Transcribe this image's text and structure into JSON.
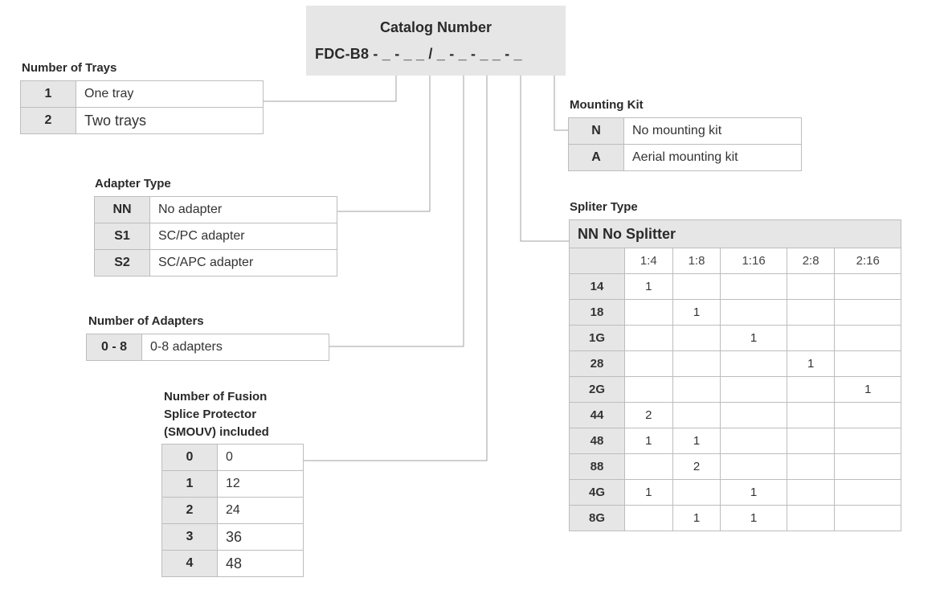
{
  "header": {
    "title": "Catalog Number",
    "code": "FDC-B8 - _ - _ _ / _ - _ - _ _ - _"
  },
  "trays": {
    "title": "Number of Trays",
    "rows": [
      {
        "key": "1",
        "value": "One tray"
      },
      {
        "key": "2",
        "value": "Two trays"
      }
    ]
  },
  "adapter_type": {
    "title": "Adapter Type",
    "rows": [
      {
        "key": "NN",
        "value": "No adapter"
      },
      {
        "key": "S1",
        "value": "SC/PC adapter"
      },
      {
        "key": "S2",
        "value": "SC/APC adapter"
      }
    ]
  },
  "num_adapters": {
    "title": "Number of Adapters",
    "rows": [
      {
        "key": "0 - 8",
        "value": "0-8 adapters"
      }
    ]
  },
  "splice": {
    "title_lines": [
      "Number of Fusion",
      "Splice Protector",
      "(SMOUV) included"
    ],
    "rows": [
      {
        "key": "0",
        "value": "0"
      },
      {
        "key": "1",
        "value": "12"
      },
      {
        "key": "2",
        "value": "24"
      },
      {
        "key": "3",
        "value": "36"
      },
      {
        "key": "4",
        "value": "48"
      }
    ]
  },
  "mounting": {
    "title": "Mounting Kit",
    "rows": [
      {
        "key": "N",
        "value": "No mounting kit"
      },
      {
        "key": "A",
        "value": "Aerial mounting kit"
      }
    ]
  },
  "splitter": {
    "title": "Spliter Type",
    "header": "NN No Splitter",
    "columns": [
      "1:4",
      "1:8",
      "1:16",
      "2:8",
      "2:16"
    ],
    "rows": [
      {
        "key": "14",
        "cells": [
          "1",
          "",
          "",
          "",
          ""
        ]
      },
      {
        "key": "18",
        "cells": [
          "",
          "1",
          "",
          "",
          ""
        ]
      },
      {
        "key": "1G",
        "cells": [
          "",
          "",
          "1",
          "",
          ""
        ]
      },
      {
        "key": "28",
        "cells": [
          "",
          "",
          "",
          "1",
          ""
        ]
      },
      {
        "key": "2G",
        "cells": [
          "",
          "",
          "",
          "",
          "1"
        ]
      },
      {
        "key": "44",
        "cells": [
          "2",
          "",
          "",
          "",
          ""
        ]
      },
      {
        "key": "48",
        "cells": [
          "1",
          "1",
          "",
          "",
          ""
        ]
      },
      {
        "key": "88",
        "cells": [
          "",
          "2",
          "",
          "",
          ""
        ]
      },
      {
        "key": "4G",
        "cells": [
          "1",
          "",
          "1",
          "",
          ""
        ]
      },
      {
        "key": "8G",
        "cells": [
          "",
          "1",
          "1",
          "",
          ""
        ]
      }
    ]
  }
}
